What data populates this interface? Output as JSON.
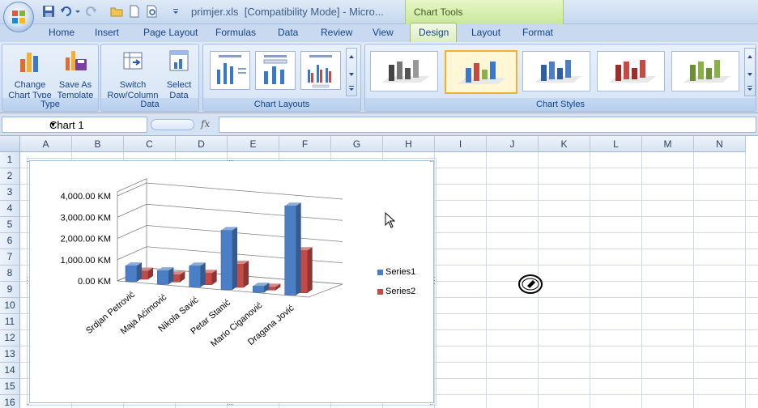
{
  "window": {
    "filename": "primjer.xls",
    "mode": "[Compatibility Mode]",
    "app_truncated": "Micro..."
  },
  "contextual_tab": {
    "label": "Chart Tools"
  },
  "tabs": [
    "Home",
    "Insert",
    "Page Layout",
    "Formulas",
    "Data",
    "Review",
    "View",
    "Design",
    "Layout",
    "Format"
  ],
  "ribbon": {
    "type_group": {
      "label": "Type",
      "change_chart_type": [
        "Change",
        "Chart Type"
      ],
      "save_as_template": [
        "Save As",
        "Template"
      ]
    },
    "data_group": {
      "label": "Data",
      "switch_row_column": [
        "Switch",
        "Row/Column"
      ],
      "select_data": [
        "Select",
        "Data"
      ]
    },
    "layouts_group": {
      "label": "Chart Layouts"
    },
    "styles_group": {
      "label": "Chart Styles"
    }
  },
  "formula_bar": {
    "name_box": "Chart 1",
    "fx": "fx",
    "formula": ""
  },
  "columns": [
    "A",
    "B",
    "C",
    "D",
    "E",
    "F",
    "G",
    "H",
    "I",
    "J",
    "K",
    "L",
    "M",
    "N"
  ],
  "rows": [
    "1",
    "2",
    "3",
    "4",
    "5",
    "6",
    "7",
    "8",
    "9",
    "10",
    "11",
    "12",
    "13",
    "14",
    "15",
    "16"
  ],
  "colors": {
    "series1": "#4a7fc6",
    "series2": "#c44a46",
    "accent": "#15428b"
  },
  "chart_data": {
    "type": "bar",
    "categories": [
      "Srdjan Petrović",
      "Maja Aćimović",
      "Nikola Savić",
      "Petar Stanić",
      "Mario Ciganović",
      "Dragana Jović"
    ],
    "series": [
      {
        "name": "Series1",
        "values": [
          750,
          650,
          1000,
          2800,
          300,
          4200
        ]
      },
      {
        "name": "Series2",
        "values": [
          400,
          350,
          550,
          1100,
          150,
          2000
        ]
      }
    ],
    "y_ticks": [
      "0.00 KM",
      "1,000.00 KM",
      "2,000.00 KM",
      "3,000.00 KM",
      "4,000.00 KM"
    ],
    "ylim": [
      0,
      4000
    ],
    "grid": true,
    "legend": "right",
    "style": "3-D clustered column"
  }
}
